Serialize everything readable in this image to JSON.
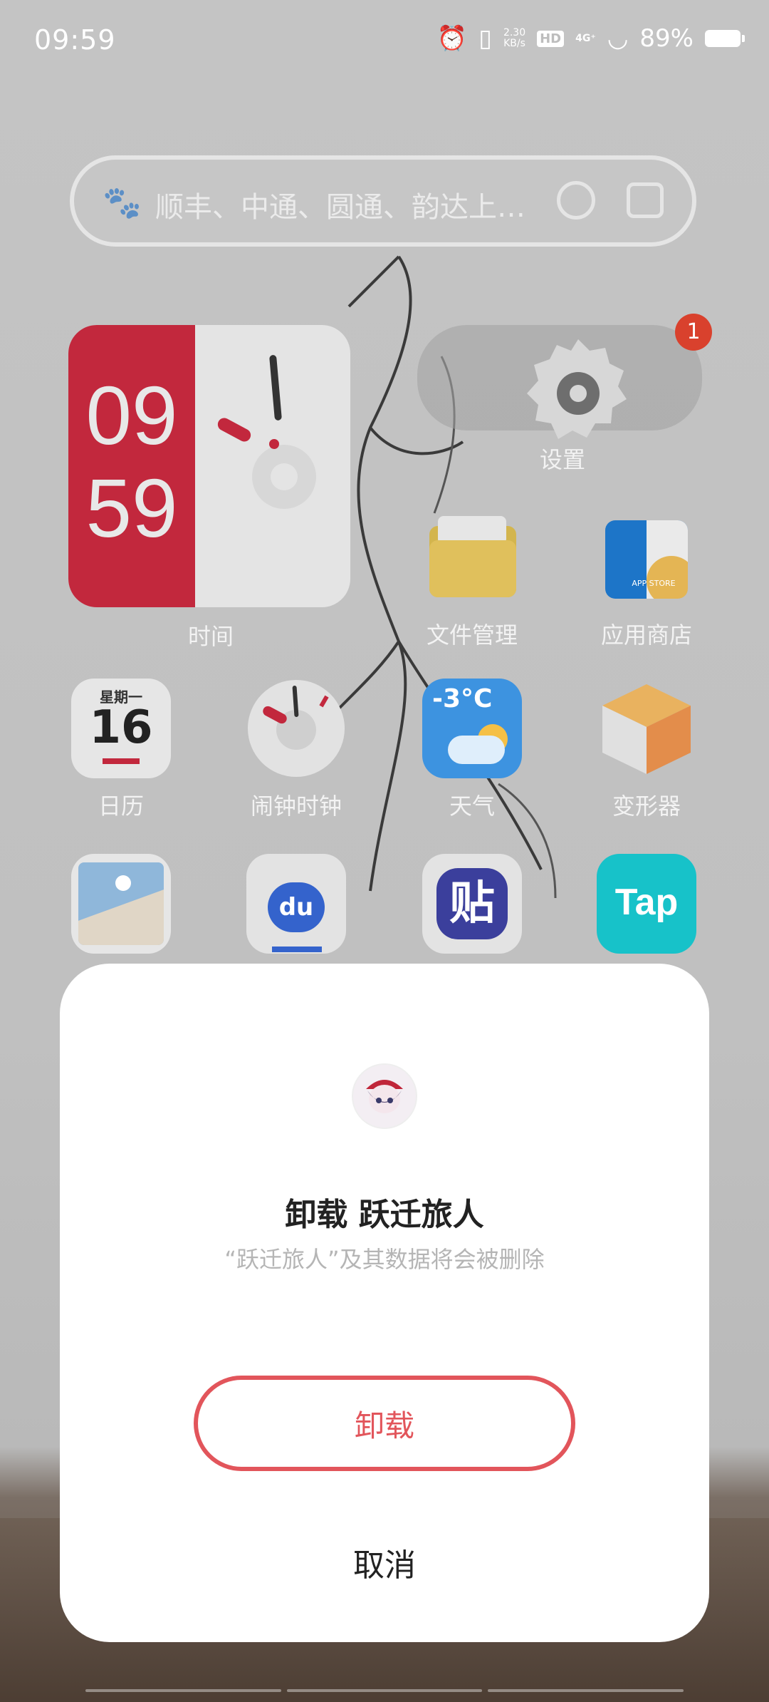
{
  "status_bar": {
    "time": "09:59",
    "net_speed": "2.30\nKB/s",
    "hd": "HD",
    "signal": "4G⁺",
    "battery": "89%"
  },
  "search": {
    "placeholder": "顺丰、中通、圆通、韵达上…"
  },
  "clock_widget": {
    "hour": "09",
    "minute": "59",
    "label": "时间"
  },
  "settings": {
    "label": "设置",
    "badge": "1"
  },
  "apps_row1": [
    {
      "label": "文件管理",
      "icon": "folder-icon"
    },
    {
      "label": "应用商店",
      "icon": "app-store-icon",
      "text": "APP STORE"
    }
  ],
  "apps_row2": [
    {
      "label": "日历",
      "icon": "calendar-icon",
      "weekday": "星期一",
      "day": "16"
    },
    {
      "label": "闹钟时钟",
      "icon": "alarm-clock-icon"
    },
    {
      "label": "天气",
      "icon": "weather-icon",
      "temp": "-3°C"
    },
    {
      "label": "变形器",
      "icon": "box-icon"
    }
  ],
  "apps_row3": [
    {
      "icon": "gallery-icon"
    },
    {
      "icon": "baidu-icon",
      "text": "du"
    },
    {
      "icon": "tieba-icon",
      "text": "贴"
    },
    {
      "icon": "taptap-icon",
      "text": "Tap"
    }
  ],
  "dialog": {
    "title": "卸载 跃迁旅人",
    "subtitle": "“跃迁旅人”及其数据将会被删除",
    "uninstall": "卸载",
    "cancel": "取消"
  }
}
